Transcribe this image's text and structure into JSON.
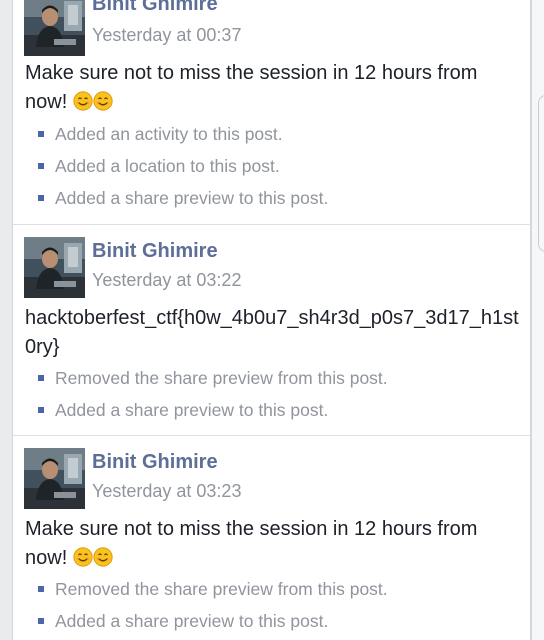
{
  "posts": [
    {
      "author": "Binit Ghimire",
      "timestamp": "Yesterday at 00:37",
      "text": "Make sure not to miss the session in 12 hours from now!",
      "emoji": [
        "smiling-face",
        "smiling-face"
      ],
      "changes": [
        "Added an activity to this post.",
        "Added a location to this post.",
        "Added a share preview to this post."
      ]
    },
    {
      "author": "Binit Ghimire",
      "timestamp": "Yesterday at 03:22",
      "text": "hacktoberfest_ctf{h0w_4b0u7_sh4r3d_p0s7_3d17_h1st0ry}",
      "emoji": [],
      "changes": [
        "Removed the share preview from this post.",
        "Added a share preview to this post."
      ]
    },
    {
      "author": "Binit Ghimire",
      "timestamp": "Yesterday at 03:23",
      "text": "Make sure not to miss the session in 12 hours from now!",
      "emoji": [
        "smiling-face",
        "smiling-face"
      ],
      "changes": [
        "Removed the share preview from this post.",
        "Added a share preview to this post."
      ]
    }
  ],
  "colors": {
    "author_name": "#5d6f98",
    "secondary_text": "#90949c",
    "bullet": "#4b67a8",
    "emoji_fill": "#f7c31c"
  }
}
